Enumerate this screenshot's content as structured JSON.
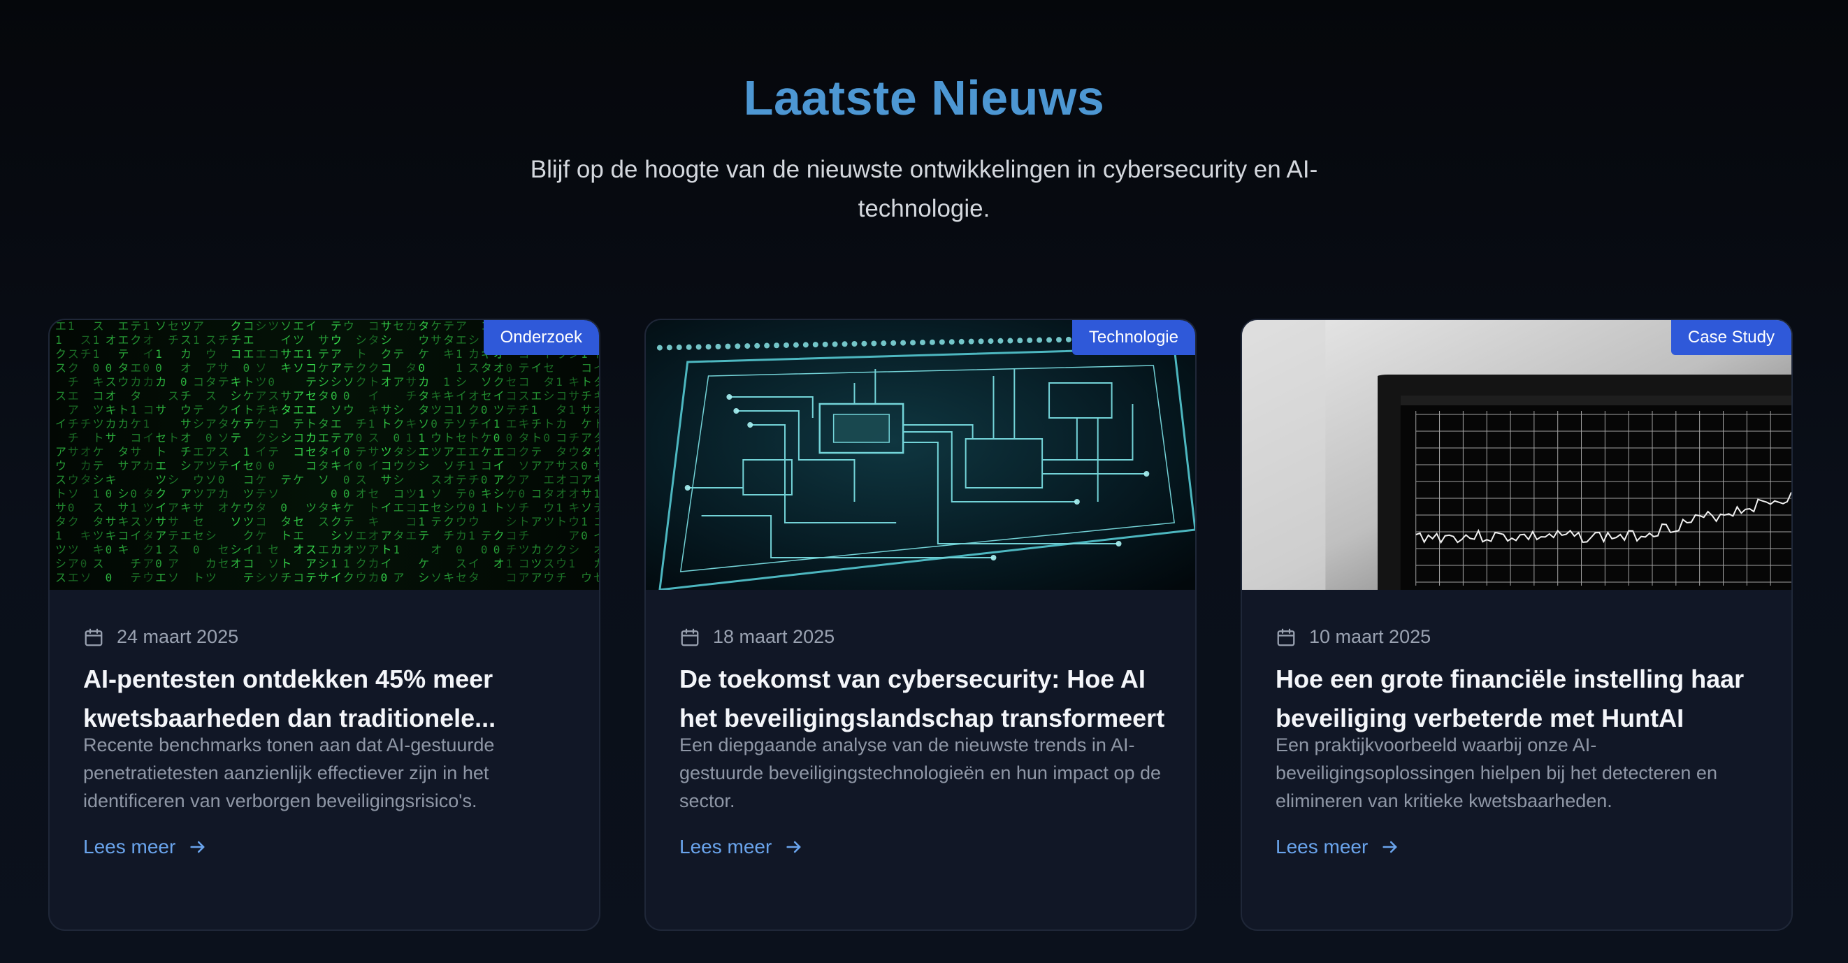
{
  "header": {
    "title": "Laatste Nieuws",
    "subtitle": "Blijf op de hoogte van de nieuwste ontwikkelingen in cybersecurity en AI-technologie."
  },
  "colors": {
    "title": "#4d97d3",
    "badge": "#2f59d9",
    "link": "#6aa4ec",
    "card_bg": "#111726"
  },
  "articles": [
    {
      "category": "Onderzoek",
      "image": "matrix-code-image",
      "date": "24 maart 2025",
      "title": "AI-pentesten ontdekken 45% meer kwetsbaarheden dan traditionele...",
      "description": "Recente benchmarks tonen aan dat AI-gestuurde penetratietesten aanzienlijk effectiever zijn in het identificeren van verborgen beveiligingsrisico's.",
      "link": "Lees meer"
    },
    {
      "category": "Technologie",
      "image": "circuit-board-image",
      "date": "18 maart 2025",
      "title": "De toekomst van cybersecurity: Hoe AI het beveiligingslandschap transformeert",
      "description": "Een diepgaande analyse van de nieuwste trends in AI-gestuurde beveiligingstechnologieën en hun impact op de sector.",
      "link": "Lees meer"
    },
    {
      "category": "Case Study",
      "image": "laptop-chart-image",
      "date": "10 maart 2025",
      "title": "Hoe een grote financiële instelling haar beveiliging verbeterde met HuntAI",
      "description": "Een praktijkvoorbeeld waarbij onze AI-beveiligingsoplossingen hielpen bij het detecteren en elimineren van kritieke kwetsbaarheden.",
      "link": "Lees meer"
    }
  ],
  "icons": {
    "date": "calendar-icon",
    "link": "arrow-right-icon"
  }
}
